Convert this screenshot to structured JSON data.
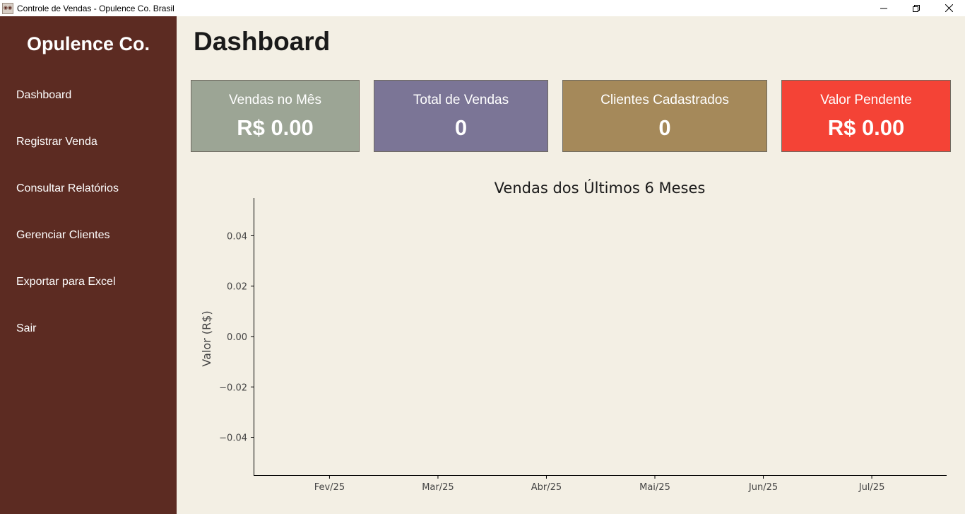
{
  "window": {
    "title": "Controle de Vendas - Opulence Co. Brasil",
    "icon": "app-logo-icon",
    "controls": [
      "minimize-icon",
      "restore-icon",
      "close-icon"
    ]
  },
  "sidebar": {
    "brand": "Opulence Co.",
    "items": [
      {
        "label": "Dashboard"
      },
      {
        "label": "Registrar Venda"
      },
      {
        "label": "Consultar Relatórios"
      },
      {
        "label": "Gerenciar Clientes"
      },
      {
        "label": "Exportar para Excel"
      },
      {
        "label": "Sair"
      }
    ]
  },
  "main": {
    "title": "Dashboard",
    "cards": [
      {
        "label": "Vendas no Mês",
        "value": "R$ 0.00",
        "color": "#9ca595"
      },
      {
        "label": "Total de Vendas",
        "value": "0",
        "color": "#7b7596"
      },
      {
        "label": "Clientes Cadastrados",
        "value": "0",
        "color": "#a5895a"
      },
      {
        "label": "Valor Pendente",
        "value": "R$ 0.00",
        "color": "#f44336"
      }
    ]
  },
  "colors": {
    "sidebar": "#5c2b22",
    "background": "#f3efe4"
  },
  "chart_data": {
    "type": "line",
    "title": "Vendas dos Últimos 6 Meses",
    "xlabel": "",
    "ylabel": "Valor (R$)",
    "categories": [
      "Fev/25",
      "Mar/25",
      "Abr/25",
      "Mai/25",
      "Jun/25",
      "Jul/25"
    ],
    "series": [],
    "ylim": [
      -0.055,
      0.055
    ],
    "yticks": [
      0.04,
      0.02,
      0.0,
      -0.02,
      -0.04
    ],
    "ytick_labels": [
      "0.04",
      "0.02",
      "0.00",
      "−0.02",
      "−0.04"
    ],
    "grid": false
  }
}
